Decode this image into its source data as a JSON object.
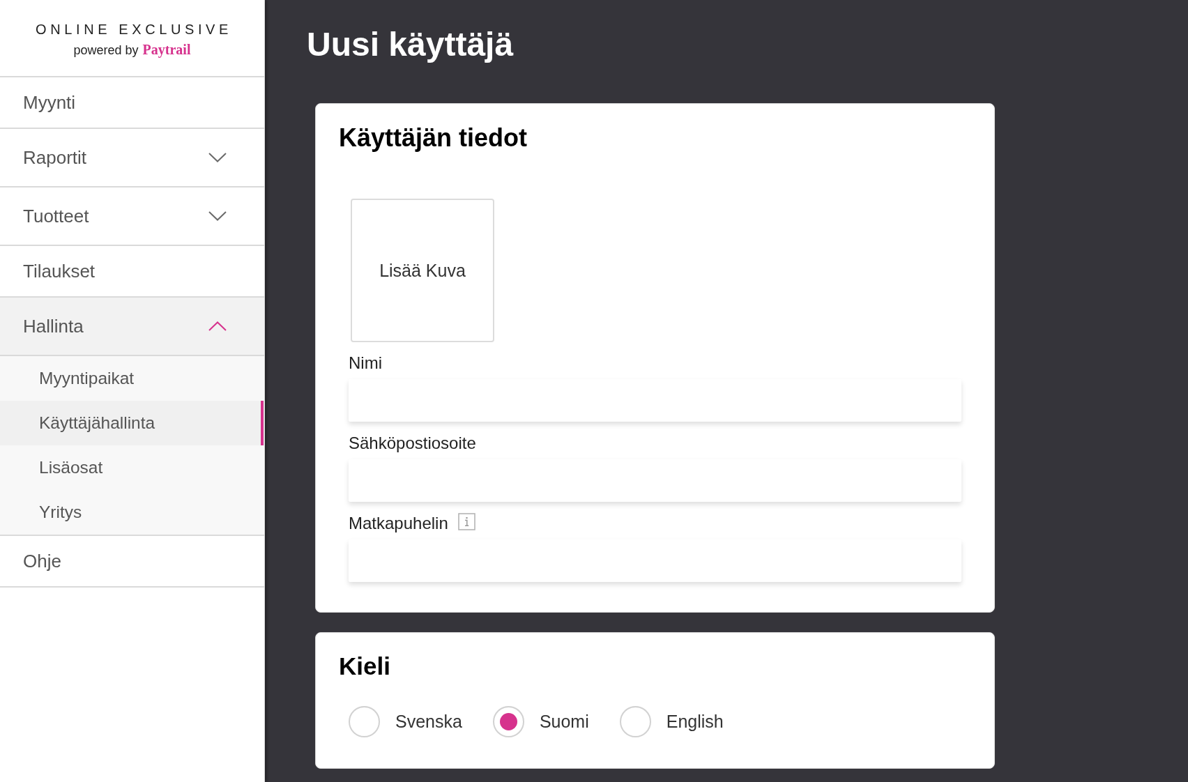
{
  "logo": {
    "title": "ONLINE EXCLUSIVE",
    "tagline": "powered by",
    "brand": "Paytrail"
  },
  "sidebar": {
    "items": [
      {
        "label": "Myynti",
        "kind": "link",
        "selected": false
      },
      {
        "label": "Raportit",
        "kind": "group",
        "expanded": false,
        "selected": false
      },
      {
        "label": "Tuotteet",
        "kind": "group",
        "expanded": false,
        "selected": false
      },
      {
        "label": "Tilaukset",
        "kind": "link",
        "selected": false
      },
      {
        "label": "Hallinta",
        "kind": "group",
        "expanded": true,
        "selected": false,
        "children": [
          {
            "label": "Myyntipaikat",
            "selected": false
          },
          {
            "label": "Käyttäjähallinta",
            "selected": true
          },
          {
            "label": "Lisäosat",
            "selected": false
          },
          {
            "label": "Yritys",
            "selected": false
          }
        ]
      },
      {
        "label": "Ohje",
        "kind": "link",
        "selected": false
      }
    ]
  },
  "page_title": "Uusi käyttäjä",
  "user_details": {
    "title": "Käyttäjän tiedot",
    "photo_button": "Lisää Kuva",
    "fields": [
      {
        "label": "Nimi",
        "info": false
      },
      {
        "label": "Sähköpostiosoite",
        "info": false
      },
      {
        "label": "Matkapuhelin",
        "info": true
      }
    ]
  },
  "language": {
    "title": "Kieli",
    "options": [
      {
        "label": "Svenska",
        "selected": false
      },
      {
        "label": "Suomi",
        "selected": true
      },
      {
        "label": "English",
        "selected": false
      }
    ]
  }
}
